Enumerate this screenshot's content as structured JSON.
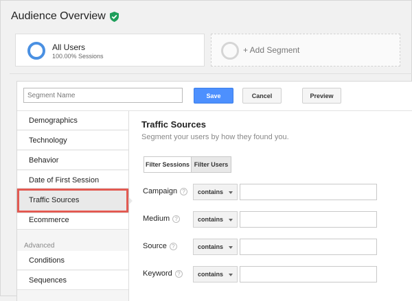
{
  "page": {
    "title": "Audience Overview"
  },
  "segments": {
    "all_users": {
      "name": "All Users",
      "sub": "100.00% Sessions"
    },
    "add_label": "+ Add Segment"
  },
  "editor": {
    "name_placeholder": "Segment Name",
    "save_label": "Save",
    "cancel_label": "Cancel",
    "preview_label": "Preview"
  },
  "sidebar": {
    "items": [
      {
        "label": "Demographics"
      },
      {
        "label": "Technology"
      },
      {
        "label": "Behavior"
      },
      {
        "label": "Date of First Session"
      },
      {
        "label": "Traffic Sources",
        "selected": true
      },
      {
        "label": "Ecommerce"
      }
    ],
    "advanced_heading": "Advanced",
    "advanced_items": [
      {
        "label": "Conditions"
      },
      {
        "label": "Sequences"
      }
    ]
  },
  "content": {
    "title": "Traffic Sources",
    "subtitle": "Segment your users by how they found you.",
    "filter_sessions": "Filter Sessions",
    "filter_users": "Filter Users",
    "filters": [
      {
        "label": "Campaign",
        "operator": "contains",
        "value": ""
      },
      {
        "label": "Medium",
        "operator": "contains",
        "value": ""
      },
      {
        "label": "Source",
        "operator": "contains",
        "value": ""
      },
      {
        "label": "Keyword",
        "operator": "contains",
        "value": ""
      }
    ]
  },
  "colors": {
    "accent": "#4d90fe",
    "ring": "#4a90e2",
    "check": "#1e9e5a",
    "highlight": "#e25a52"
  }
}
